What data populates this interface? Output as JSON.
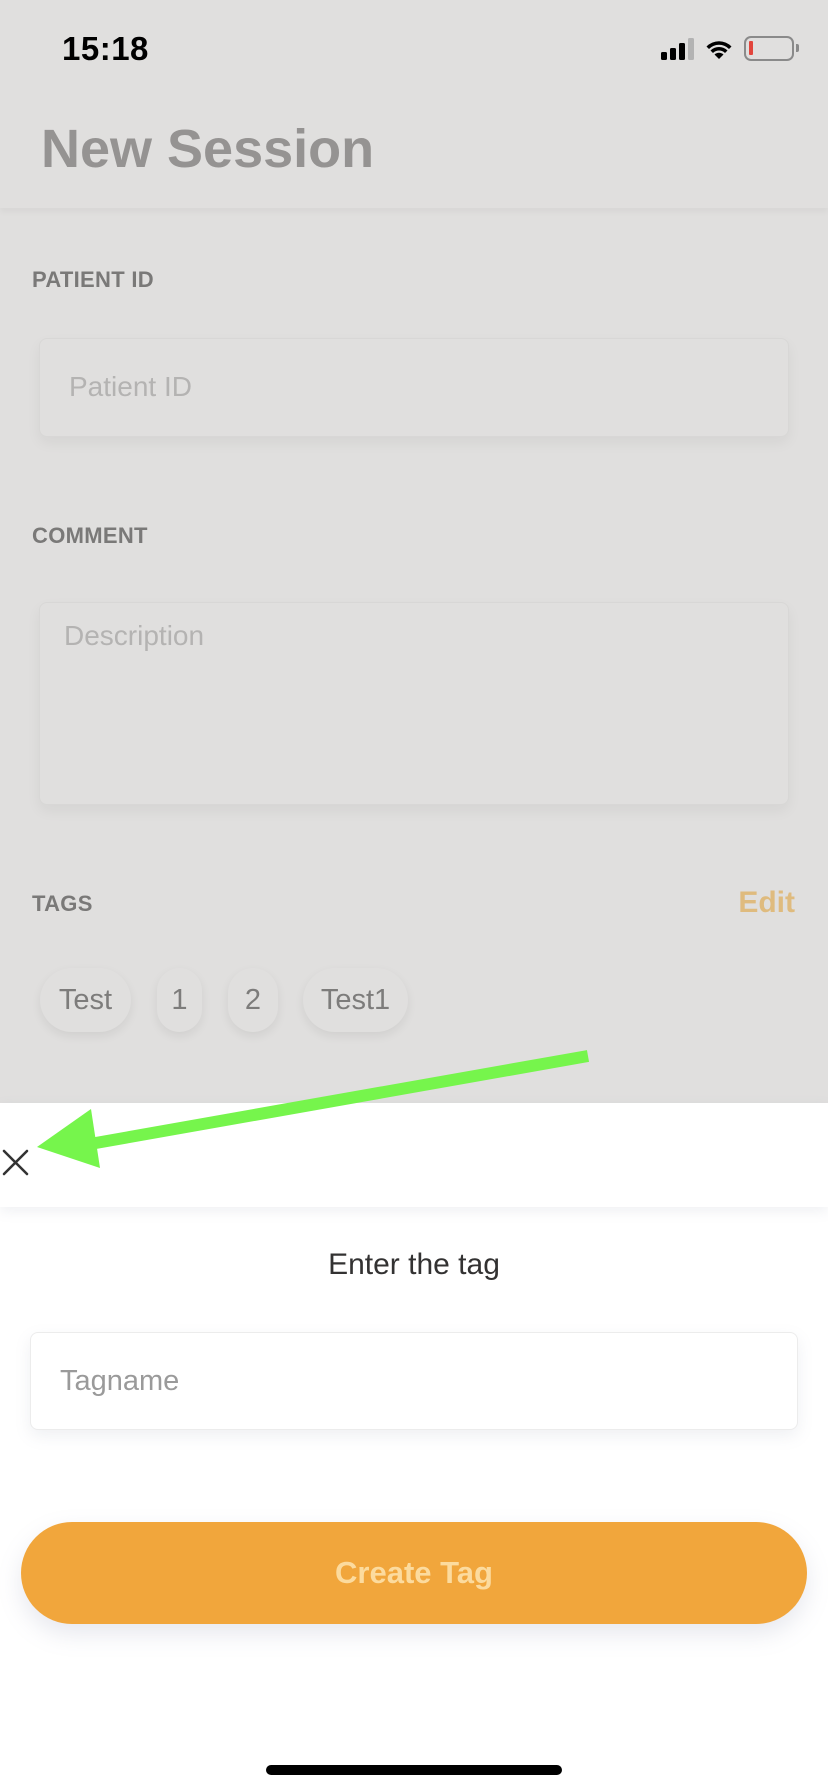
{
  "status_bar": {
    "time": "15:18",
    "icons": [
      "cellular-signal-icon",
      "wifi-icon",
      "battery-low-icon"
    ],
    "battery_color": "#e2453c"
  },
  "header": {
    "title": "New Session"
  },
  "form": {
    "patient_id": {
      "label": "PATIENT ID",
      "placeholder": "Patient ID",
      "value": ""
    },
    "comment": {
      "label": "COMMENT",
      "placeholder": "Description",
      "value": ""
    },
    "tags": {
      "label": "TAGS",
      "edit_label": "Edit",
      "items": [
        "Test",
        "1",
        "2",
        "Test1"
      ]
    }
  },
  "sheet": {
    "close_icon": "close-x-icon",
    "title": "Enter the tag",
    "input": {
      "placeholder": "Tagname",
      "value": ""
    },
    "submit_label": "Create Tag"
  },
  "colors": {
    "accent": "#f1a63c",
    "accent_text_disabled": "#fcdb9e",
    "overlay_background": "#e0dfde",
    "annotation_arrow": "#76f54c"
  },
  "annotation": {
    "type": "arrow",
    "points_to": "close-button"
  }
}
